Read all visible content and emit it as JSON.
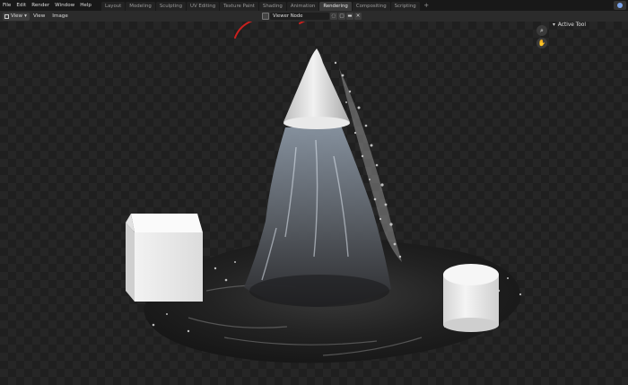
{
  "menu": [
    "File",
    "Edit",
    "Render",
    "Window",
    "Help"
  ],
  "workspaces": [
    {
      "label": "Layout",
      "active": false
    },
    {
      "label": "Modeling",
      "active": false
    },
    {
      "label": "Sculpting",
      "active": false
    },
    {
      "label": "UV Editing",
      "active": false
    },
    {
      "label": "Texture Paint",
      "active": false
    },
    {
      "label": "Shading",
      "active": false
    },
    {
      "label": "Animation",
      "active": false
    },
    {
      "label": "Rendering",
      "active": true
    },
    {
      "label": "Compositing",
      "active": false
    },
    {
      "label": "Scripting",
      "active": false
    }
  ],
  "add_workspace": "+",
  "header": {
    "editor_type": "View",
    "menus": [
      "View",
      "Image"
    ],
    "image_name": "Viewer Node",
    "close_glyph": "✕"
  },
  "sidebar": {
    "active_tool_label": "Active Tool"
  },
  "icons": {
    "zoom": "magnify-icon",
    "pan": "hand-icon"
  },
  "colors": {
    "annotation_stroke": "#c8201e",
    "active_tab": "#3a3a3a",
    "accent": "#7aa2e8"
  }
}
